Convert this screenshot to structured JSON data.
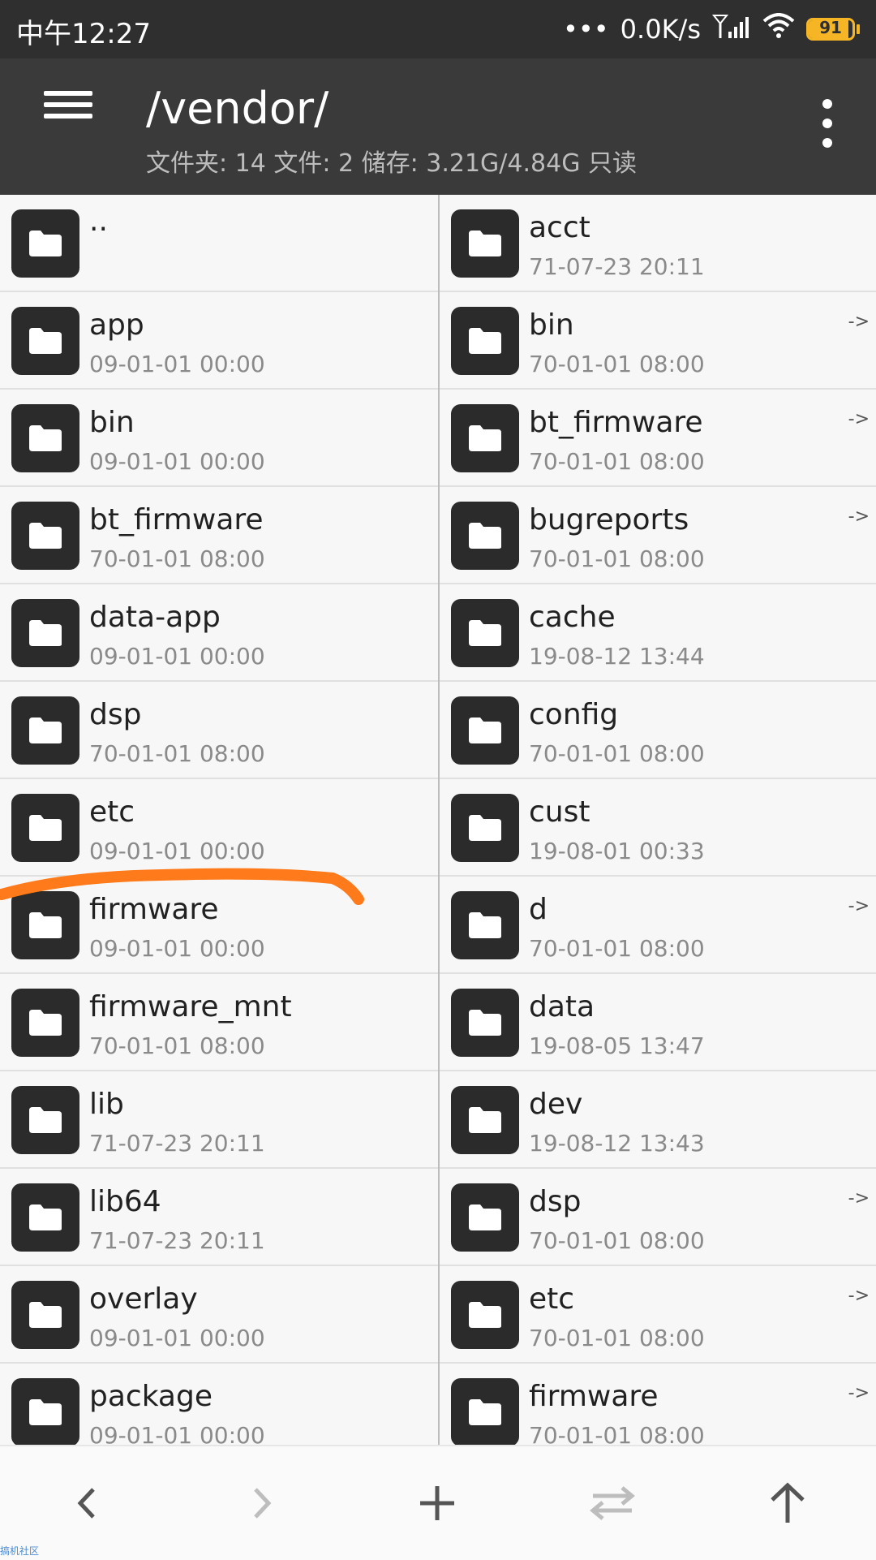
{
  "status": {
    "time": "中午12:27",
    "speed": "0.0K/s",
    "battery": "91",
    "battery_level": 0.91
  },
  "header": {
    "title": "/vendor/",
    "subtitle": "文件夹: 14  文件: 2  储存: 3.21G/4.84G  只读",
    "menu_icon": "menu-icon",
    "more_icon": "more-vert-icon"
  },
  "left_pane": {
    "items": [
      {
        "name": "..",
        "date": ""
      },
      {
        "name": "app",
        "date": "09-01-01 00:00"
      },
      {
        "name": "bin",
        "date": "09-01-01 00:00"
      },
      {
        "name": "bt_firmware",
        "date": "70-01-01 08:00"
      },
      {
        "name": "data-app",
        "date": "09-01-01 00:00"
      },
      {
        "name": "dsp",
        "date": "70-01-01 08:00"
      },
      {
        "name": "etc",
        "date": "09-01-01 00:00"
      },
      {
        "name": "firmware",
        "date": "09-01-01 00:00"
      },
      {
        "name": "firmware_mnt",
        "date": "70-01-01 08:00"
      },
      {
        "name": "lib",
        "date": "71-07-23 20:11"
      },
      {
        "name": "lib64",
        "date": "71-07-23 20:11"
      },
      {
        "name": "overlay",
        "date": "09-01-01 00:00"
      },
      {
        "name": "package",
        "date": "09-01-01 00:00"
      }
    ]
  },
  "right_pane": {
    "items": [
      {
        "name": "acct",
        "date": "71-07-23 20:11",
        "link": ""
      },
      {
        "name": "bin",
        "date": "70-01-01 08:00",
        "link": "->"
      },
      {
        "name": "bt_firmware",
        "date": "70-01-01 08:00",
        "link": "->"
      },
      {
        "name": "bugreports",
        "date": "70-01-01 08:00",
        "link": "->"
      },
      {
        "name": "cache",
        "date": "19-08-12 13:44",
        "link": ""
      },
      {
        "name": "config",
        "date": "70-01-01 08:00",
        "link": ""
      },
      {
        "name": "cust",
        "date": "19-08-01 00:33",
        "link": ""
      },
      {
        "name": "d",
        "date": "70-01-01 08:00",
        "link": "->"
      },
      {
        "name": "data",
        "date": "19-08-05 13:47",
        "link": ""
      },
      {
        "name": "dev",
        "date": "19-08-12 13:43",
        "link": ""
      },
      {
        "name": "dsp",
        "date": "70-01-01 08:00",
        "link": "->"
      },
      {
        "name": "etc",
        "date": "70-01-01 08:00",
        "link": "->"
      },
      {
        "name": "firmware",
        "date": "70-01-01 08:00",
        "link": "->"
      }
    ]
  },
  "bottom_bar": {
    "buttons": [
      "back-icon",
      "forward-icon",
      "add-icon",
      "swap-icon",
      "up-icon"
    ]
  },
  "watermark": "搞机社区",
  "colors": {
    "status_bar": "#2f2f2f",
    "app_bar": "#3a3a3a",
    "battery": "#f5b525",
    "annotation": "#ff7a1a"
  }
}
